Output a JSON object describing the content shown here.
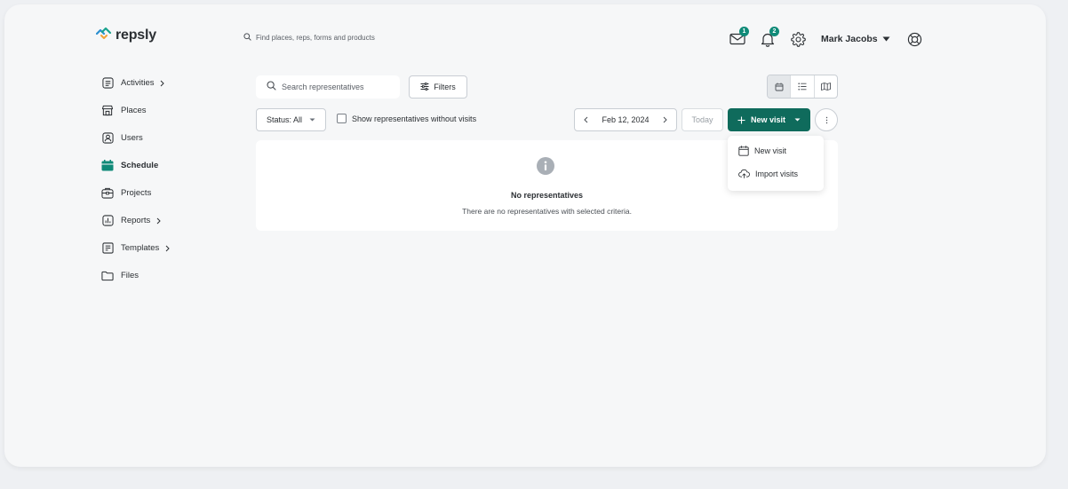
{
  "app": {
    "logo_text": "repsly",
    "accent_color": "#0f6b5c",
    "badge_color": "#0f8a78"
  },
  "header": {
    "search_placeholder": "Find places, reps, forms and products",
    "messages_badge": "1",
    "notifications_badge": "2",
    "user_name": "Mark Jacobs"
  },
  "sidebar": {
    "items": [
      {
        "label": "Activities",
        "icon": "activities-icon",
        "has_chevron": true
      },
      {
        "label": "Places",
        "icon": "store-icon",
        "has_chevron": false
      },
      {
        "label": "Users",
        "icon": "user-icon",
        "has_chevron": false
      },
      {
        "label": "Schedule",
        "icon": "calendar-icon",
        "has_chevron": false,
        "active": true
      },
      {
        "label": "Projects",
        "icon": "projects-icon",
        "has_chevron": false
      },
      {
        "label": "Reports",
        "icon": "reports-icon",
        "has_chevron": true
      },
      {
        "label": "Templates",
        "icon": "templates-icon",
        "has_chevron": true
      },
      {
        "label": "Files",
        "icon": "folder-icon",
        "has_chevron": false
      }
    ]
  },
  "toolbar": {
    "search_placeholder": "Search representatives",
    "filters_label": "Filters",
    "status_label": "Status: All",
    "checkbox_label": "Show representatives without visits",
    "date_label": "Feb 12, 2024",
    "today_label": "Today",
    "new_visit_label": "New visit"
  },
  "dropdown": {
    "items": [
      {
        "label": "New visit",
        "icon": "calendar-icon"
      },
      {
        "label": "Import visits",
        "icon": "cloud-upload-icon"
      }
    ]
  },
  "empty_state": {
    "title": "No representatives",
    "description": "There are no representatives with selected criteria."
  }
}
